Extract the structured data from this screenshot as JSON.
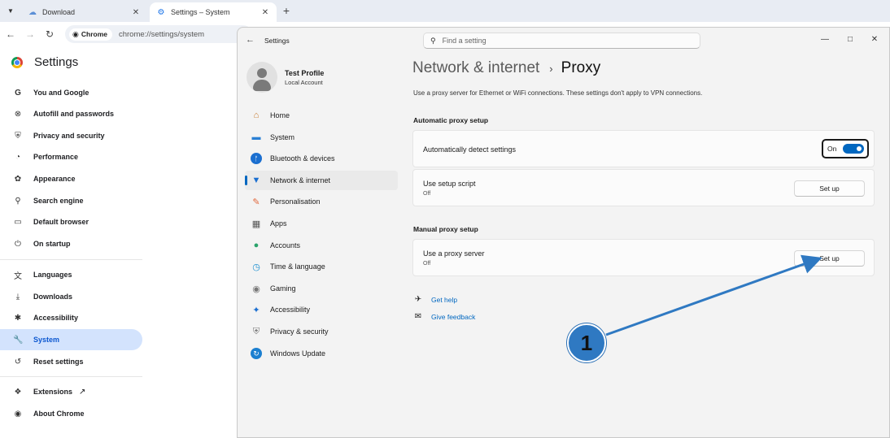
{
  "browser": {
    "tabs": [
      {
        "title": "Download",
        "icon": "cloud-icon"
      },
      {
        "title": "Settings – System",
        "icon": "gear-icon"
      }
    ],
    "chip_label": "Chrome",
    "url": "chrome://settings/system"
  },
  "chrome_settings": {
    "title": "Settings",
    "items": [
      {
        "label": "You and Google",
        "icon": "google-icon"
      },
      {
        "label": "Autofill and passwords",
        "icon": "key-icon"
      },
      {
        "label": "Privacy and security",
        "icon": "shield-icon"
      },
      {
        "label": "Performance",
        "icon": "speedometer-icon"
      },
      {
        "label": "Appearance",
        "icon": "palette-icon"
      },
      {
        "label": "Search engine",
        "icon": "search-icon"
      },
      {
        "label": "Default browser",
        "icon": "browser-icon"
      },
      {
        "label": "On startup",
        "icon": "power-icon"
      },
      {
        "label": "Languages",
        "icon": "translate-icon"
      },
      {
        "label": "Downloads",
        "icon": "download-icon"
      },
      {
        "label": "Accessibility",
        "icon": "accessibility-icon"
      },
      {
        "label": "System",
        "icon": "wrench-icon"
      },
      {
        "label": "Reset settings",
        "icon": "reset-icon"
      },
      {
        "label": "Extensions",
        "icon": "puzzle-icon"
      },
      {
        "label": "About Chrome",
        "icon": "chrome-icon"
      }
    ],
    "selected": "System"
  },
  "win_settings": {
    "title": "Settings",
    "search_placeholder": "Find a setting",
    "profile": {
      "name": "Test Profile",
      "sub": "Local Account"
    },
    "nav": [
      {
        "label": "Home",
        "icon": "home-icon"
      },
      {
        "label": "System",
        "icon": "monitor-icon"
      },
      {
        "label": "Bluetooth & devices",
        "icon": "bluetooth-icon"
      },
      {
        "label": "Network & internet",
        "icon": "wifi-icon"
      },
      {
        "label": "Personalisation",
        "icon": "brush-icon"
      },
      {
        "label": "Apps",
        "icon": "apps-icon"
      },
      {
        "label": "Accounts",
        "icon": "person-icon"
      },
      {
        "label": "Time & language",
        "icon": "globe-clock-icon"
      },
      {
        "label": "Gaming",
        "icon": "gamepad-icon"
      },
      {
        "label": "Accessibility",
        "icon": "accessibility-icon"
      },
      {
        "label": "Privacy & security",
        "icon": "shield-icon"
      },
      {
        "label": "Windows Update",
        "icon": "update-icon"
      }
    ],
    "selected_nav": "Network & internet",
    "breadcrumb": {
      "parent": "Network & internet",
      "sep": "›",
      "current": "Proxy"
    },
    "description": "Use a proxy server for Ethernet or WiFi connections. These settings don't apply to VPN connections.",
    "auto_section": "Automatic proxy setup",
    "auto_detect": {
      "label": "Automatically detect settings",
      "state": "On",
      "on": true
    },
    "setup_script": {
      "label": "Use setup script",
      "sub": "Off",
      "button": "Set up"
    },
    "manual_section": "Manual proxy setup",
    "proxy_server": {
      "label": "Use a proxy server",
      "sub": "Off",
      "button": "Set up"
    },
    "links": [
      {
        "label": "Get help",
        "icon": "help-icon"
      },
      {
        "label": "Give feedback",
        "icon": "feedback-icon"
      }
    ]
  },
  "annotation": {
    "marker": "1",
    "color": "#2f79c2"
  }
}
